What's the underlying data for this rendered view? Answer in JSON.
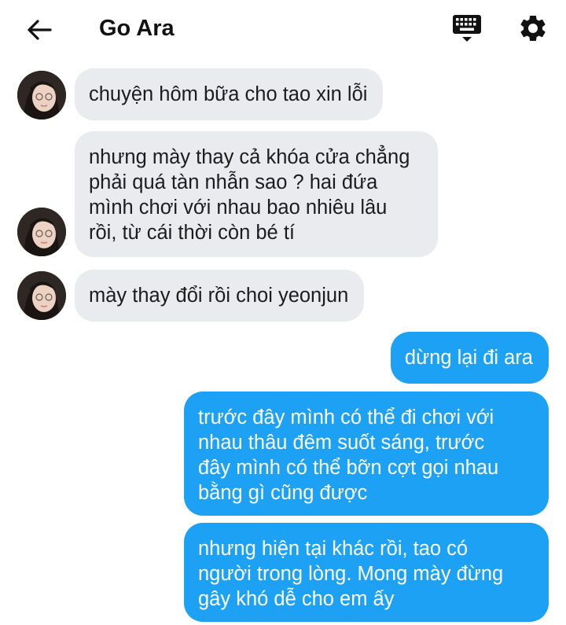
{
  "header": {
    "title": "Go Ara",
    "back_icon": "arrow-left-icon",
    "keyboard_icon": "keyboard-icon",
    "settings_icon": "gear-icon"
  },
  "messages": [
    {
      "direction": "received",
      "text": "chuyện hôm bữa cho tao xin lỗi"
    },
    {
      "direction": "received",
      "text": "nhưng mày thay cả khóa cửa chẳng\nphải quá tàn nhẫn sao ? hai đứa\nmình chơi với nhau bao nhiêu lâu\nrồi, từ cái thời còn bé tí"
    },
    {
      "direction": "received",
      "text": "mày thay đổi rồi choi yeonjun"
    },
    {
      "direction": "sent",
      "text": "dừng lại đi ara"
    },
    {
      "direction": "sent",
      "text": "trước đây mình có thể đi chơi với\nnhau thâu đêm suốt sáng, trước\nđây mình có thể bỡn cợt gọi nhau\nbằng gì cũng được"
    },
    {
      "direction": "sent",
      "text": "nhưng hiện tại khác rồi, tao có\nngười trong lòng. Mong mày đừng\ngây khó dễ cho em ấy"
    }
  ],
  "colors": {
    "sent_bubble": "#1da1f5",
    "received_bubble": "#e9ebef",
    "text_dark": "#1c1c1c"
  }
}
